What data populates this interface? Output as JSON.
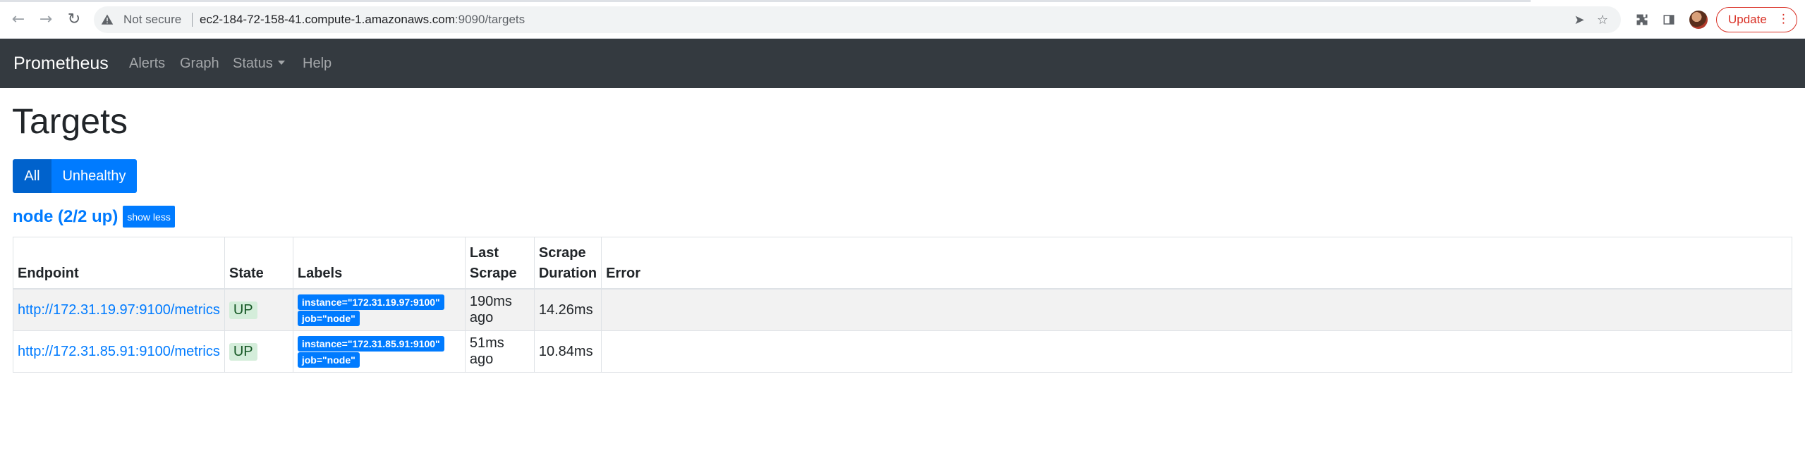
{
  "browser": {
    "security_label": "Not secure",
    "url_host": "ec2-184-72-158-41.compute-1.amazonaws.com",
    "url_rest": ":9090/targets",
    "update_label": "Update"
  },
  "navbar": {
    "brand": "Prometheus",
    "links": [
      "Alerts",
      "Graph",
      "Status",
      "Help"
    ]
  },
  "main": {
    "title": "Targets",
    "filter_buttons": [
      "All",
      "Unhealthy"
    ],
    "job": {
      "name": "node (2/2 up)",
      "toggle_label": "show less"
    },
    "table": {
      "headers": {
        "endpoint": "Endpoint",
        "state": "State",
        "labels": "Labels",
        "last_scrape": "Last Scrape",
        "scrape_duration_1": "Scrape",
        "scrape_duration_2": "Duration",
        "error": "Error"
      },
      "rows": [
        {
          "endpoint": "http://172.31.19.97:9100/metrics",
          "state": "UP",
          "labels": [
            "instance=\"172.31.19.97:9100\"",
            "job=\"node\""
          ],
          "last_scrape": "190ms ago",
          "duration": "14.26ms",
          "error": ""
        },
        {
          "endpoint": "http://172.31.85.91:9100/metrics",
          "state": "UP",
          "labels": [
            "instance=\"172.31.85.91:9100\"",
            "job=\"node\""
          ],
          "last_scrape": "51ms ago",
          "duration": "10.84ms",
          "error": ""
        }
      ]
    }
  },
  "colors": {
    "navbar_bg": "#343a40",
    "primary": "#007bff",
    "primary_active": "#0062cc",
    "up_bg": "#d4edda",
    "up_text": "#155724"
  }
}
